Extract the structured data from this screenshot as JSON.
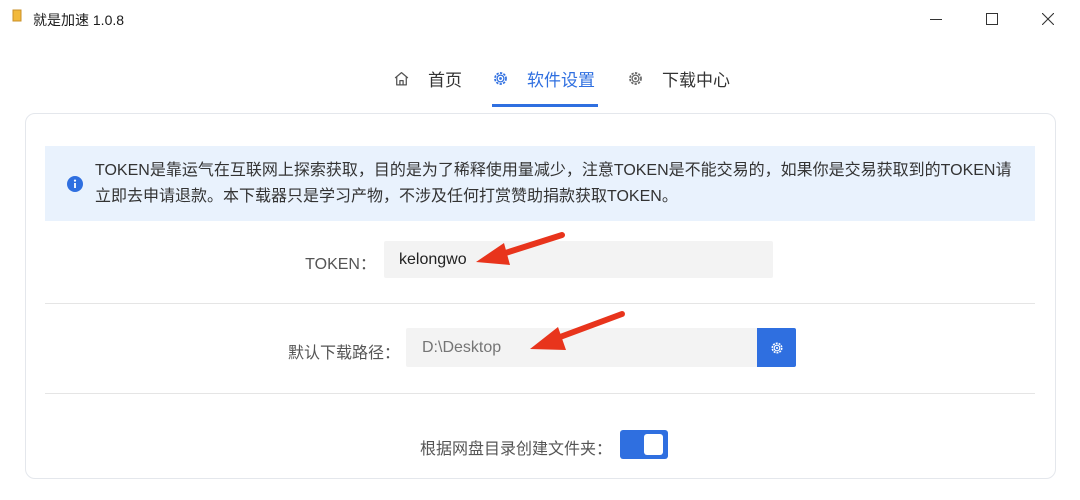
{
  "window": {
    "title": "就是加速  1.0.8",
    "icon": "app-icon",
    "controls": [
      "minimize-icon",
      "maximize-icon",
      "close-icon"
    ]
  },
  "tabs": [
    {
      "label": "首页",
      "icon": "home-icon",
      "active": false
    },
    {
      "label": "软件设置",
      "icon": "gear-icon",
      "active": true
    },
    {
      "label": "下载中心",
      "icon": "gear-icon",
      "active": false
    }
  ],
  "alert": {
    "icon": "info-icon",
    "text": "TOKEN是靠运气在互联网上探索获取，目的是为了稀释使用量减少，注意TOKEN是不能交易的，如果你是交易获取到的TOKEN请立即去申请退款。本下载器只是学习产物，不涉及任何打赏赞助捐款获取TOKEN。"
  },
  "settings": {
    "token": {
      "label": "TOKEN：",
      "value": "kelongwo"
    },
    "download_path": {
      "label": "默认下载路径：",
      "placeholder": "D:\\Desktop",
      "button_icon": "gear-icon"
    },
    "create_folder": {
      "label": "根据网盘目录创建文件夹：",
      "enabled": true
    }
  },
  "colors": {
    "accent": "#2f6fe0",
    "alert_bg": "#e9f2fd",
    "annotation_arrow": "#e8341c"
  }
}
